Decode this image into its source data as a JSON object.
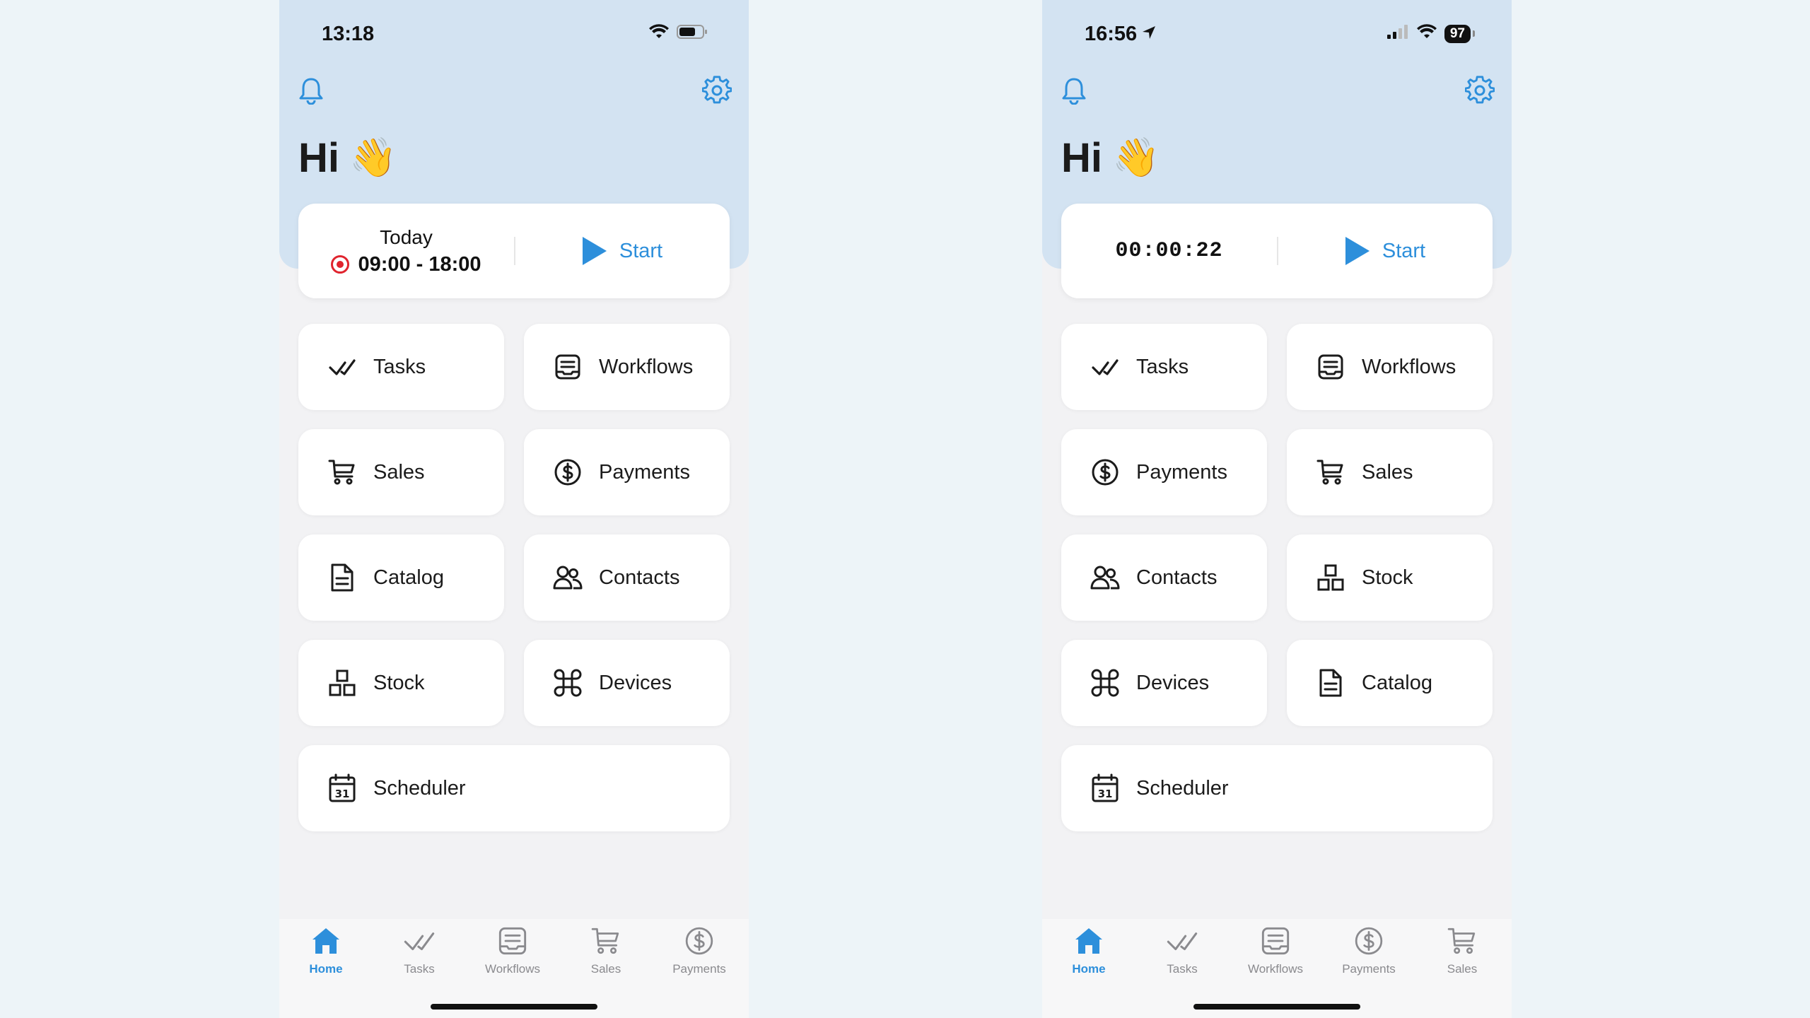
{
  "left": {
    "status": {
      "time": "13:18"
    },
    "greeting": "Hi",
    "greeting_emoji": "👋",
    "shift": {
      "label": "Today",
      "hours": "09:00 - 18:00"
    },
    "start_label": "Start",
    "tiles": [
      {
        "label": "Tasks",
        "icon": "check-icon"
      },
      {
        "label": "Workflows",
        "icon": "workflows-icon"
      },
      {
        "label": "Sales",
        "icon": "cart-icon"
      },
      {
        "label": "Payments",
        "icon": "dollar-icon"
      },
      {
        "label": "Catalog",
        "icon": "document-icon"
      },
      {
        "label": "Contacts",
        "icon": "contacts-icon"
      },
      {
        "label": "Stock",
        "icon": "stock-icon"
      },
      {
        "label": "Devices",
        "icon": "command-icon"
      },
      {
        "label": "Scheduler",
        "icon": "calendar-icon"
      }
    ],
    "tabs": [
      {
        "label": "Home",
        "icon": "home-icon",
        "active": true
      },
      {
        "label": "Tasks",
        "icon": "check-icon"
      },
      {
        "label": "Workflows",
        "icon": "workflows-icon"
      },
      {
        "label": "Sales",
        "icon": "cart-icon"
      },
      {
        "label": "Payments",
        "icon": "dollar-icon"
      }
    ]
  },
  "right": {
    "status": {
      "time": "16:56",
      "battery": "97"
    },
    "greeting": "Hi",
    "greeting_emoji": "👋",
    "timer": "00:00:22",
    "start_label": "Start",
    "tiles": [
      {
        "label": "Tasks",
        "icon": "check-icon"
      },
      {
        "label": "Workflows",
        "icon": "workflows-icon"
      },
      {
        "label": "Payments",
        "icon": "dollar-icon"
      },
      {
        "label": "Sales",
        "icon": "cart-icon"
      },
      {
        "label": "Contacts",
        "icon": "contacts-icon"
      },
      {
        "label": "Stock",
        "icon": "stock-icon"
      },
      {
        "label": "Devices",
        "icon": "command-icon"
      },
      {
        "label": "Catalog",
        "icon": "document-icon"
      },
      {
        "label": "Scheduler",
        "icon": "calendar-icon"
      }
    ],
    "tabs": [
      {
        "label": "Home",
        "icon": "home-icon",
        "active": true
      },
      {
        "label": "Tasks",
        "icon": "check-icon"
      },
      {
        "label": "Workflows",
        "icon": "workflows-icon"
      },
      {
        "label": "Payments",
        "icon": "dollar-icon"
      },
      {
        "label": "Sales",
        "icon": "cart-icon"
      }
    ]
  },
  "colors": {
    "accent": "#2d8fdb",
    "hero_bg": "#d3e3f2",
    "record_red": "#e0242e",
    "text": "#1b1b1b",
    "tab_inactive": "#8a8a8e"
  }
}
